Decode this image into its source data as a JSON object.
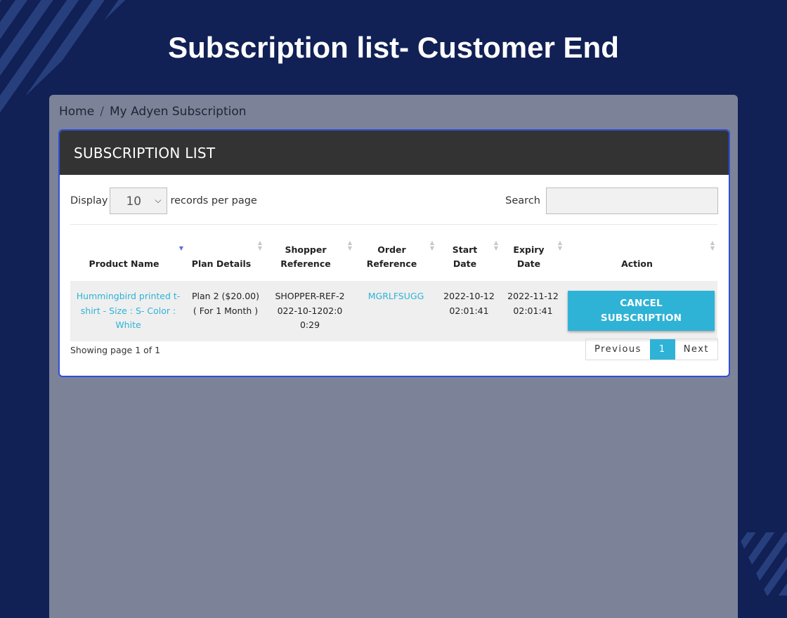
{
  "page": {
    "title": "Subscription list- Customer End"
  },
  "breadcrumb": {
    "home": "Home",
    "separator": "/",
    "current": "My Adyen Subscription"
  },
  "panel": {
    "title": "SUBSCRIPTION LIST"
  },
  "controls": {
    "display_label": "Display",
    "records_value": "10",
    "records_suffix": "records per page",
    "search_label": "Search",
    "search_value": ""
  },
  "table": {
    "columns": [
      {
        "line1": "",
        "line2": "Product Name"
      },
      {
        "line1": "",
        "line2": "Plan Details"
      },
      {
        "line1": "Shopper",
        "line2": "Reference"
      },
      {
        "line1": "Order",
        "line2": "Reference"
      },
      {
        "line1": "Start",
        "line2": "Date"
      },
      {
        "line1": "Expiry",
        "line2": "Date"
      },
      {
        "line1": "",
        "line2": "Action"
      }
    ],
    "rows": [
      {
        "product_name": "Hummingbird printed t-shirt - Size : S- Color : White",
        "plan_details_1": "Plan 2 ($20.00)",
        "plan_details_2": "( For 1 Month )",
        "shopper_reference": "SHOPPER-REF-2022-10-1202:00:29",
        "order_reference": "MGRLFSUGG",
        "start_date": "2022-10-12",
        "start_time": "02:01:41",
        "expiry_date": "2022-11-12",
        "expiry_time": "02:01:41",
        "action_label": "CANCEL SUBSCRIPTION"
      }
    ]
  },
  "pagination": {
    "showing": "Showing page 1 of 1",
    "previous": "Previous",
    "current": "1",
    "next": "Next"
  },
  "colors": {
    "background": "#112055",
    "accent": "#2eb3d6",
    "panel_header": "#333333",
    "panel_border": "#2f4fd8"
  }
}
